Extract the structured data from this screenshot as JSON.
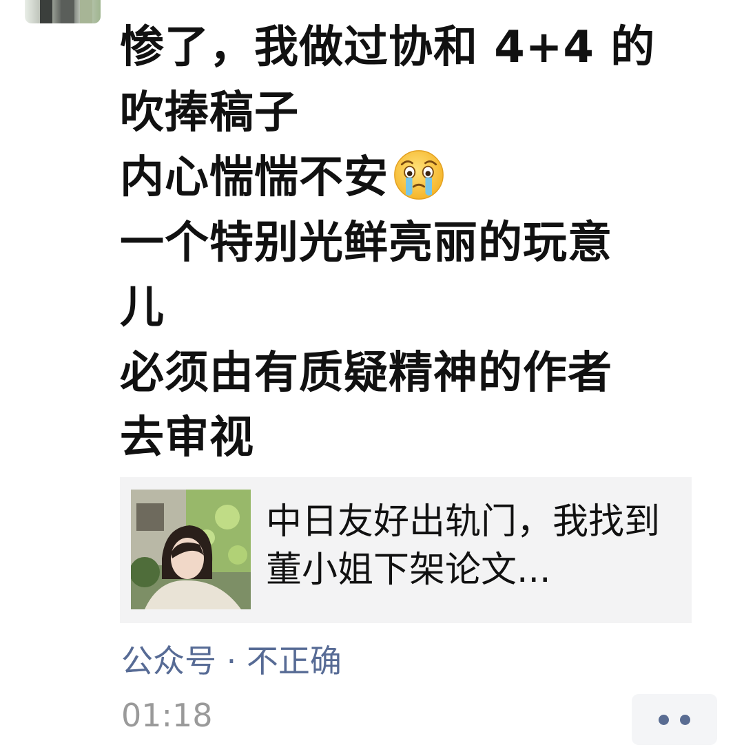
{
  "post": {
    "lines": [
      "惨了，我做过协和 4+4 的",
      "吹捧稿子",
      "内心惴惴不安",
      "一个特别光鲜亮丽的玩意",
      "儿",
      "必须由有质疑精神的作者",
      "去审视"
    ],
    "emoji": "crying-face-emoji"
  },
  "article": {
    "title": "中日友好出轨门，我找到董小姐下架论文..."
  },
  "meta": {
    "source": "公众号 · 不正确",
    "time": "01:18"
  },
  "colors": {
    "link": "#576b95",
    "time": "#9a9a9a",
    "card_bg": "#f3f3f4"
  }
}
